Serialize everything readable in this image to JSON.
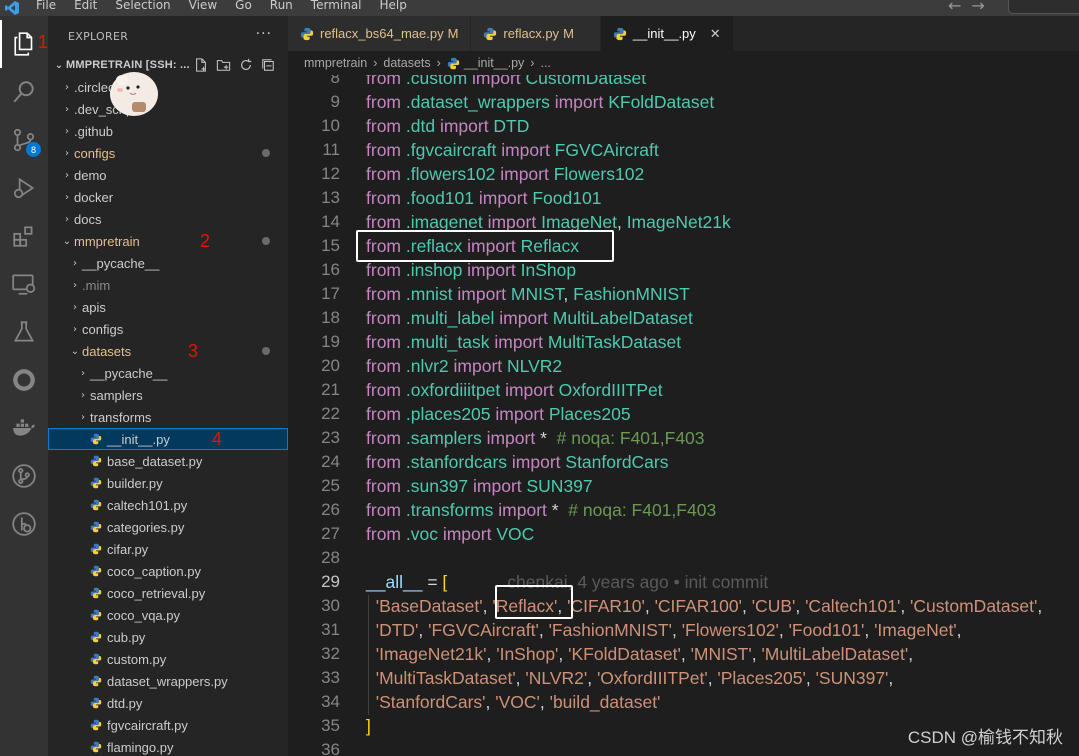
{
  "menubar": {
    "items": [
      "File",
      "Edit",
      "Selection",
      "View",
      "Go",
      "Run",
      "Terminal",
      "Help"
    ]
  },
  "activitybar": {
    "items": [
      {
        "icon": "explorer-icon",
        "annotation": "1"
      },
      {
        "icon": "search-icon"
      },
      {
        "icon": "source-control-icon",
        "badge": "8"
      },
      {
        "icon": "run-debug-icon"
      },
      {
        "icon": "extensions-icon"
      },
      {
        "icon": "remote-explorer-icon"
      },
      {
        "icon": "testing-icon"
      },
      {
        "icon": "github-icon"
      },
      {
        "icon": "docker-icon"
      },
      {
        "icon": "git-graph-icon"
      },
      {
        "icon": "gitlens-icon"
      }
    ]
  },
  "sidebar": {
    "title": "EXPLORER",
    "more": "···",
    "root": "MMPRETRAIN [SSH: ...",
    "tree": [
      {
        "label": ".circleci",
        "depth": 1,
        "kind": "folder",
        "open": false
      },
      {
        "label": ".dev_scripts",
        "depth": 1,
        "kind": "folder",
        "open": false
      },
      {
        "label": ".github",
        "depth": 1,
        "kind": "folder",
        "open": false
      },
      {
        "label": "configs",
        "depth": 1,
        "kind": "folder",
        "open": false,
        "modified": true
      },
      {
        "label": "demo",
        "depth": 1,
        "kind": "folder",
        "open": false
      },
      {
        "label": "docker",
        "depth": 1,
        "kind": "folder",
        "open": false
      },
      {
        "label": "docs",
        "depth": 1,
        "kind": "folder",
        "open": false
      },
      {
        "label": "mmpretrain",
        "depth": 1,
        "kind": "folder",
        "open": true,
        "modified": true,
        "annotation": "2"
      },
      {
        "label": "__pycache__",
        "depth": 2,
        "kind": "folder",
        "open": false
      },
      {
        "label": ".mim",
        "depth": 2,
        "kind": "folder",
        "open": false,
        "dim": true
      },
      {
        "label": "apis",
        "depth": 2,
        "kind": "folder",
        "open": false
      },
      {
        "label": "configs",
        "depth": 2,
        "kind": "folder",
        "open": false
      },
      {
        "label": "datasets",
        "depth": 2,
        "kind": "folder",
        "open": true,
        "modified": true,
        "annotation": "3"
      },
      {
        "label": "__pycache__",
        "depth": 3,
        "kind": "folder",
        "open": false
      },
      {
        "label": "samplers",
        "depth": 3,
        "kind": "folder",
        "open": false
      },
      {
        "label": "transforms",
        "depth": 3,
        "kind": "folder",
        "open": false
      },
      {
        "label": "__init__.py",
        "depth": 3,
        "kind": "file",
        "selected": true,
        "annotation": "4"
      },
      {
        "label": "base_dataset.py",
        "depth": 3,
        "kind": "file"
      },
      {
        "label": "builder.py",
        "depth": 3,
        "kind": "file"
      },
      {
        "label": "caltech101.py",
        "depth": 3,
        "kind": "file"
      },
      {
        "label": "categories.py",
        "depth": 3,
        "kind": "file"
      },
      {
        "label": "cifar.py",
        "depth": 3,
        "kind": "file"
      },
      {
        "label": "coco_caption.py",
        "depth": 3,
        "kind": "file"
      },
      {
        "label": "coco_retrieval.py",
        "depth": 3,
        "kind": "file"
      },
      {
        "label": "coco_vqa.py",
        "depth": 3,
        "kind": "file"
      },
      {
        "label": "cub.py",
        "depth": 3,
        "kind": "file"
      },
      {
        "label": "custom.py",
        "depth": 3,
        "kind": "file"
      },
      {
        "label": "dataset_wrappers.py",
        "depth": 3,
        "kind": "file"
      },
      {
        "label": "dtd.py",
        "depth": 3,
        "kind": "file"
      },
      {
        "label": "fgvcaircraft.py",
        "depth": 3,
        "kind": "file"
      },
      {
        "label": "flamingo.py",
        "depth": 3,
        "kind": "file"
      }
    ]
  },
  "tabs": [
    {
      "label": "reflacx_bs64_mae.py",
      "status": "M",
      "active": false
    },
    {
      "label": "reflacx.py",
      "status": "M",
      "active": false
    },
    {
      "label": "__init__.py",
      "status": "",
      "active": true,
      "close": "✕"
    }
  ],
  "breadcrumb": [
    "mmpretrain",
    "datasets",
    "__init__.py",
    "..."
  ],
  "editor": {
    "lines": [
      {
        "n": "8",
        "tokens": [
          [
            "kw",
            "from "
          ],
          [
            "mod",
            ".custom "
          ],
          [
            "kw",
            "import "
          ],
          [
            "cls",
            "CustomDataset"
          ]
        ]
      },
      {
        "n": "9",
        "tokens": [
          [
            "kw",
            "from "
          ],
          [
            "mod",
            ".dataset_wrappers "
          ],
          [
            "kw",
            "import "
          ],
          [
            "cls",
            "KFoldDataset"
          ]
        ]
      },
      {
        "n": "10",
        "tokens": [
          [
            "kw",
            "from "
          ],
          [
            "mod",
            ".dtd "
          ],
          [
            "kw",
            "import "
          ],
          [
            "cls",
            "DTD"
          ]
        ]
      },
      {
        "n": "11",
        "tokens": [
          [
            "kw",
            "from "
          ],
          [
            "mod",
            ".fgvcaircraft "
          ],
          [
            "kw",
            "import "
          ],
          [
            "cls",
            "FGVCAircraft"
          ]
        ]
      },
      {
        "n": "12",
        "tokens": [
          [
            "kw",
            "from "
          ],
          [
            "mod",
            ".flowers102 "
          ],
          [
            "kw",
            "import "
          ],
          [
            "cls",
            "Flowers102"
          ]
        ]
      },
      {
        "n": "13",
        "tokens": [
          [
            "kw",
            "from "
          ],
          [
            "mod",
            ".food101 "
          ],
          [
            "kw",
            "import "
          ],
          [
            "cls",
            "Food101"
          ]
        ]
      },
      {
        "n": "14",
        "tokens": [
          [
            "kw",
            "from "
          ],
          [
            "mod",
            ".imagenet "
          ],
          [
            "kw",
            "import "
          ],
          [
            "cls",
            "ImageNet"
          ],
          [
            "plain",
            ", "
          ],
          [
            "cls",
            "ImageNet21k"
          ]
        ]
      },
      {
        "n": "15",
        "tokens": [
          [
            "kw",
            "from "
          ],
          [
            "mod",
            ".reflacx "
          ],
          [
            "kw",
            "import "
          ],
          [
            "cls",
            "Reflacx"
          ]
        ]
      },
      {
        "n": "16",
        "tokens": [
          [
            "kw",
            "from "
          ],
          [
            "mod",
            ".inshop "
          ],
          [
            "kw",
            "import "
          ],
          [
            "cls",
            "InShop"
          ]
        ]
      },
      {
        "n": "17",
        "tokens": [
          [
            "kw",
            "from "
          ],
          [
            "mod",
            ".mnist "
          ],
          [
            "kw",
            "import "
          ],
          [
            "cls",
            "MNIST"
          ],
          [
            "plain",
            ", "
          ],
          [
            "cls",
            "FashionMNIST"
          ]
        ]
      },
      {
        "n": "18",
        "tokens": [
          [
            "kw",
            "from "
          ],
          [
            "mod",
            ".multi_label "
          ],
          [
            "kw",
            "import "
          ],
          [
            "cls",
            "MultiLabelDataset"
          ]
        ]
      },
      {
        "n": "19",
        "tokens": [
          [
            "kw",
            "from "
          ],
          [
            "mod",
            ".multi_task "
          ],
          [
            "kw",
            "import "
          ],
          [
            "cls",
            "MultiTaskDataset"
          ]
        ]
      },
      {
        "n": "20",
        "tokens": [
          [
            "kw",
            "from "
          ],
          [
            "mod",
            ".nlvr2 "
          ],
          [
            "kw",
            "import "
          ],
          [
            "cls",
            "NLVR2"
          ]
        ]
      },
      {
        "n": "21",
        "tokens": [
          [
            "kw",
            "from "
          ],
          [
            "mod",
            ".oxfordiiitpet "
          ],
          [
            "kw",
            "import "
          ],
          [
            "cls",
            "OxfordIIITPet"
          ]
        ]
      },
      {
        "n": "22",
        "tokens": [
          [
            "kw",
            "from "
          ],
          [
            "mod",
            ".places205 "
          ],
          [
            "kw",
            "import "
          ],
          [
            "cls",
            "Places205"
          ]
        ]
      },
      {
        "n": "23",
        "tokens": [
          [
            "kw",
            "from "
          ],
          [
            "mod",
            ".samplers "
          ],
          [
            "kw",
            "import "
          ],
          [
            "plain",
            "*  "
          ],
          [
            "cmt",
            "# noqa: F401,F403"
          ]
        ]
      },
      {
        "n": "24",
        "tokens": [
          [
            "kw",
            "from "
          ],
          [
            "mod",
            ".stanfordcars "
          ],
          [
            "kw",
            "import "
          ],
          [
            "cls",
            "StanfordCars"
          ]
        ]
      },
      {
        "n": "25",
        "tokens": [
          [
            "kw",
            "from "
          ],
          [
            "mod",
            ".sun397 "
          ],
          [
            "kw",
            "import "
          ],
          [
            "cls",
            "SUN397"
          ]
        ]
      },
      {
        "n": "26",
        "tokens": [
          [
            "kw",
            "from "
          ],
          [
            "mod",
            ".transforms "
          ],
          [
            "kw",
            "import "
          ],
          [
            "plain",
            "*  "
          ],
          [
            "cmt",
            "# noqa: F401,F403"
          ]
        ]
      },
      {
        "n": "27",
        "tokens": [
          [
            "kw",
            "from "
          ],
          [
            "mod",
            ".voc "
          ],
          [
            "kw",
            "import "
          ],
          [
            "cls",
            "VOC"
          ]
        ]
      },
      {
        "n": "28",
        "tokens": []
      },
      {
        "n": "29",
        "current": true,
        "tokens": [
          [
            "var",
            "__all__"
          ],
          [
            "plain",
            " = "
          ],
          [
            "brk",
            "["
          ],
          [
            "blame",
            "chenkai, 4 years ago • init commit"
          ]
        ]
      },
      {
        "n": "30",
        "tokens": [
          [
            "plain",
            "  "
          ],
          [
            "str",
            "'BaseDataset'"
          ],
          [
            "plain",
            ", "
          ],
          [
            "str",
            "'Reflacx'"
          ],
          [
            "plain",
            ", "
          ],
          [
            "str",
            "'CIFAR10'"
          ],
          [
            "plain",
            ", "
          ],
          [
            "str",
            "'CIFAR100'"
          ],
          [
            "plain",
            ", "
          ],
          [
            "str",
            "'CUB'"
          ],
          [
            "plain",
            ", "
          ],
          [
            "str",
            "'Caltech101'"
          ],
          [
            "plain",
            ", "
          ],
          [
            "str",
            "'CustomDataset'"
          ],
          [
            "plain",
            ","
          ]
        ]
      },
      {
        "n": "31",
        "tokens": [
          [
            "plain",
            "  "
          ],
          [
            "str",
            "'DTD'"
          ],
          [
            "plain",
            ", "
          ],
          [
            "str",
            "'FGVCAircraft'"
          ],
          [
            "plain",
            ", "
          ],
          [
            "str",
            "'FashionMNIST'"
          ],
          [
            "plain",
            ", "
          ],
          [
            "str",
            "'Flowers102'"
          ],
          [
            "plain",
            ", "
          ],
          [
            "str",
            "'Food101'"
          ],
          [
            "plain",
            ", "
          ],
          [
            "str",
            "'ImageNet'"
          ],
          [
            "plain",
            ","
          ]
        ]
      },
      {
        "n": "32",
        "tokens": [
          [
            "plain",
            "  "
          ],
          [
            "str",
            "'ImageNet21k'"
          ],
          [
            "plain",
            ", "
          ],
          [
            "str",
            "'InShop'"
          ],
          [
            "plain",
            ", "
          ],
          [
            "str",
            "'KFoldDataset'"
          ],
          [
            "plain",
            ", "
          ],
          [
            "str",
            "'MNIST'"
          ],
          [
            "plain",
            ", "
          ],
          [
            "str",
            "'MultiLabelDataset'"
          ],
          [
            "plain",
            ","
          ]
        ]
      },
      {
        "n": "33",
        "tokens": [
          [
            "plain",
            "  "
          ],
          [
            "str",
            "'MultiTaskDataset'"
          ],
          [
            "plain",
            ", "
          ],
          [
            "str",
            "'NLVR2'"
          ],
          [
            "plain",
            ", "
          ],
          [
            "str",
            "'OxfordIIITPet'"
          ],
          [
            "plain",
            ", "
          ],
          [
            "str",
            "'Places205'"
          ],
          [
            "plain",
            ", "
          ],
          [
            "str",
            "'SUN397'"
          ],
          [
            "plain",
            ","
          ]
        ]
      },
      {
        "n": "34",
        "tokens": [
          [
            "plain",
            "  "
          ],
          [
            "str",
            "'StanfordCars'"
          ],
          [
            "plain",
            ", "
          ],
          [
            "str",
            "'VOC'"
          ],
          [
            "plain",
            ", "
          ],
          [
            "str",
            "'build_dataset'"
          ]
        ]
      },
      {
        "n": "35",
        "tokens": [
          [
            "brk",
            "]"
          ]
        ]
      },
      {
        "n": "36",
        "tokens": []
      }
    ]
  },
  "watermark": "CSDN @榆钱不知秋",
  "colors": {
    "keyword": "#c586c0",
    "module": "#4ec9b0",
    "string": "#ce9178",
    "comment": "#6a9955",
    "annotation_red": "#e51400",
    "modified": "#e2c08d",
    "selection": "#04395e"
  }
}
